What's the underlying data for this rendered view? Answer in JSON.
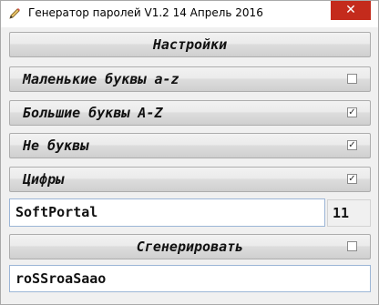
{
  "window": {
    "title": "Генератор паролей  V1.2  14  Апрель 2016",
    "close_icon": "close-icon",
    "app_icon": "pencil-icon"
  },
  "settings_button": {
    "label": "Настройки"
  },
  "options": [
    {
      "label": "Маленькие буквы a-z",
      "checked": false
    },
    {
      "label": "Большие буквы A-Z",
      "checked": true
    },
    {
      "label": "Не буквы",
      "checked": true
    },
    {
      "label": "Цифры",
      "checked": true
    }
  ],
  "seed_input": {
    "value": "SoftPortal"
  },
  "length": {
    "value": "11"
  },
  "generate": {
    "label": "Сгенерировать",
    "checked": false
  },
  "output": {
    "value": "roSSroaSaao"
  },
  "colors": {
    "close_button": "#c42b1c",
    "field_border": "#9cb6d6",
    "window_bg": "#f0f0f0"
  }
}
